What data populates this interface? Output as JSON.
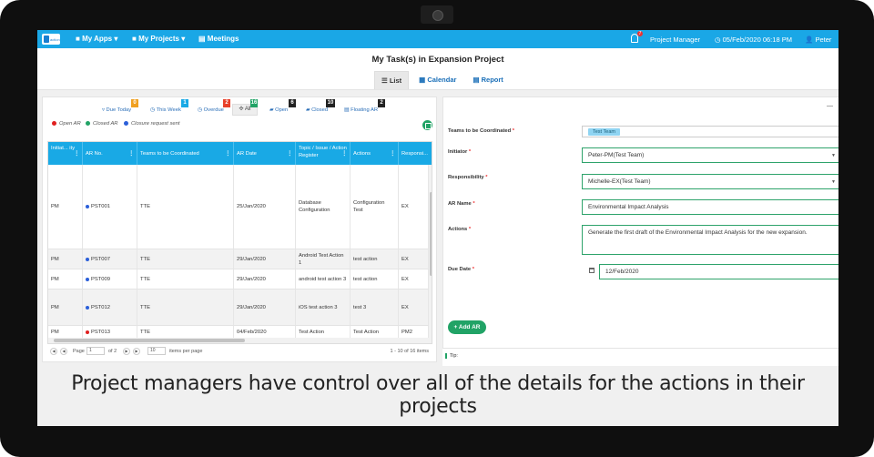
{
  "nav": {
    "logo_text": "action",
    "my_apps": "My Apps",
    "my_projects": "My Projects",
    "meetings": "Meetings",
    "notification_count": "7",
    "role": "Project Manager",
    "datetime": "05/Feb/2020 06:18 PM",
    "user": "Peter"
  },
  "page": {
    "title": "My Task(s) in Expansion Project",
    "tabs": {
      "list": "List",
      "calendar": "Calendar",
      "report": "Report"
    }
  },
  "filters": {
    "due_today": "Due Today",
    "due_today_count": "0",
    "this_week": "This Week",
    "this_week_count": "1",
    "overdue": "Overdue",
    "overdue_count": "2",
    "all": "All",
    "all_count": "16",
    "open": "Open",
    "open_count": "6",
    "closed": "Closed",
    "closed_count": "10",
    "floating": "Floating AR",
    "floating_count": "2"
  },
  "legend": {
    "open_ar": "Open AR",
    "closed_ar": "Closed AR",
    "closure": "Closure request sent"
  },
  "grid": {
    "columns": [
      "Initiat... ity",
      "AR No.",
      "Teams to be Coordinated",
      "AR Date",
      "Topic / Issue / Action Register",
      "Actions",
      "Responsi..."
    ],
    "rows": [
      {
        "initiator": "PM",
        "ar_no": "PST001",
        "team": "TTE",
        "date": "25/Jan/2020",
        "topic": "Database Configuration",
        "action": "Configuration Test",
        "resp": "EX",
        "dot": "#2b5fd9"
      },
      {
        "initiator": "PM",
        "ar_no": "PST007",
        "team": "TTE",
        "date": "29/Jan/2020",
        "topic": "Android Test Action 1",
        "action": "test action",
        "resp": "EX",
        "dot": "#2b5fd9"
      },
      {
        "initiator": "PM",
        "ar_no": "PST009",
        "team": "TTE",
        "date": "29/Jan/2020",
        "topic": "android test action 3",
        "action": "test action",
        "resp": "EX",
        "dot": "#2b5fd9"
      },
      {
        "initiator": "PM",
        "ar_no": "PST012",
        "team": "TTE",
        "date": "29/Jan/2020",
        "topic": "iOS test action 3",
        "action": "test 3",
        "resp": "EX",
        "dot": "#2b5fd9"
      },
      {
        "initiator": "PM",
        "ar_no": "PST013",
        "team": "TTE",
        "date": "04/Feb/2020",
        "topic": "Test Action",
        "action": "Test Action",
        "resp": "PM2",
        "dot": "#e02020"
      }
    ]
  },
  "pager": {
    "page_label": "Page",
    "page_value": "1",
    "of": "of 2",
    "page_size": "10",
    "items_per_page": "items per page",
    "summary": "1 - 10 of 16 items"
  },
  "form": {
    "teams_label": "Teams to be Coordinated",
    "teams_tag": "Test Team",
    "initiator_label": "Initiator",
    "initiator_value": "Peter-PM(Test Team)",
    "responsibility_label": "Responsibility",
    "responsibility_value": "Michelle-EX(Test Team)",
    "ar_name_label": "AR Name",
    "ar_name_value": "Environmental Impact Analysis",
    "actions_label": "Actions",
    "actions_value": "Generate the first draft of the Environmental Impact Analysis for the new expansion.",
    "due_date_label": "Due Date",
    "due_date_value": "12/Feb/2020",
    "add_ar": "+ Add AR",
    "req_mark": "*"
  },
  "tip": "Tip:",
  "caption": "Project managers have control over all of the details for the actions in their projects",
  "colors": {
    "nav": "#1aa7e6",
    "grid_header": "#19a9e5",
    "accent_green": "#21a366"
  }
}
